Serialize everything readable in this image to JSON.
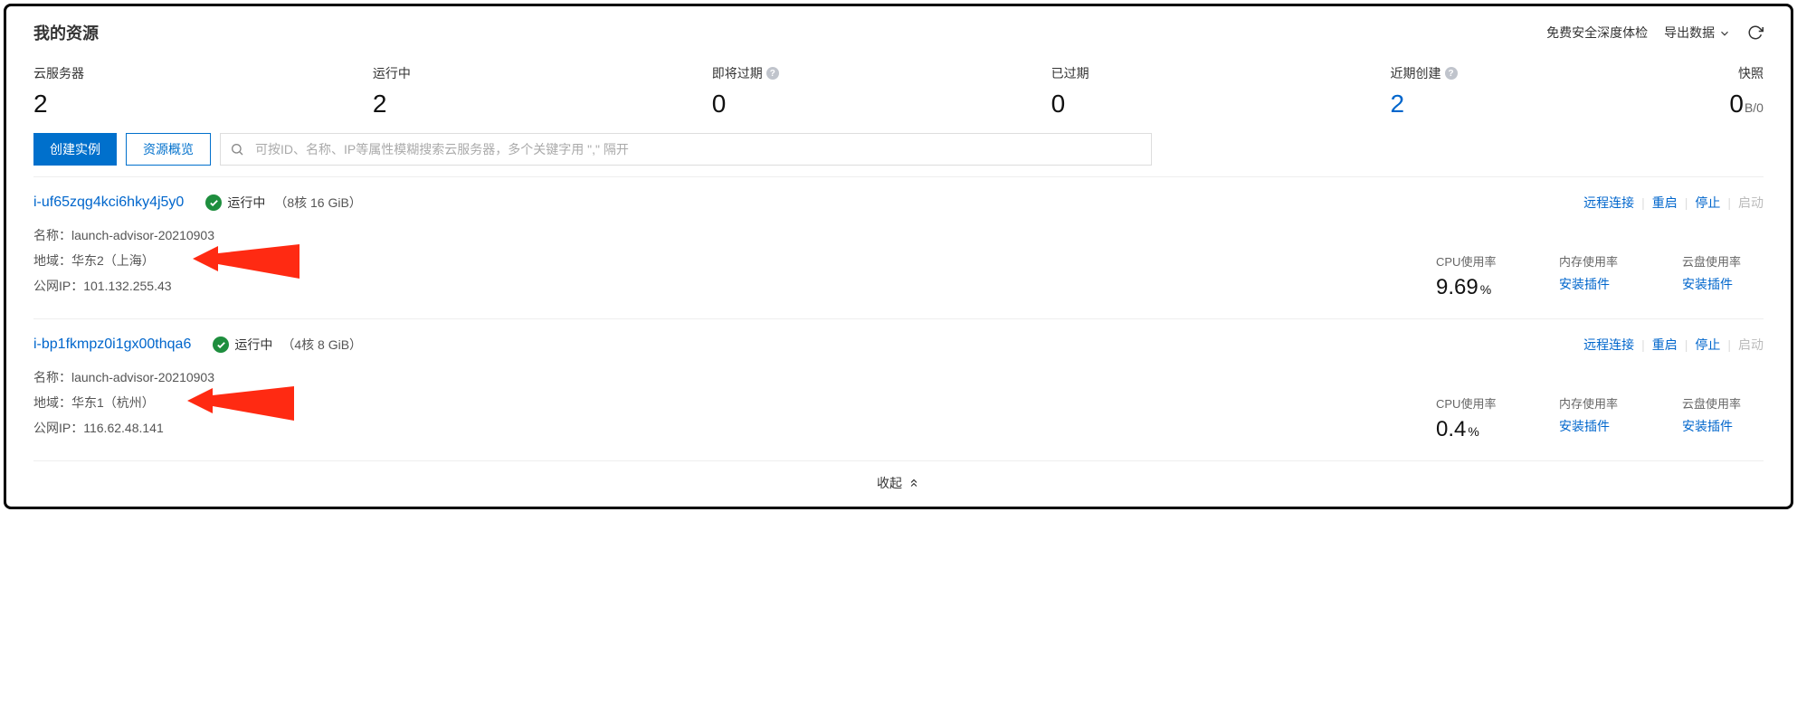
{
  "header": {
    "title": "我的资源",
    "security_check": "免费安全深度体检",
    "export": "导出数据"
  },
  "stats": {
    "servers": {
      "label": "云服务器",
      "value": "2"
    },
    "running": {
      "label": "运行中",
      "value": "2"
    },
    "expiring": {
      "label": "即将过期",
      "value": "0"
    },
    "expired": {
      "label": "已过期",
      "value": "0"
    },
    "recent": {
      "label": "近期创建",
      "value": "2"
    },
    "snapshot": {
      "label": "快照",
      "value": "0",
      "suffix": "B/0"
    }
  },
  "toolbar": {
    "create": "创建实例",
    "overview": "资源概览",
    "search_placeholder": "可按ID、名称、IP等属性模糊搜索云服务器，多个关键字用 \",\" 隔开"
  },
  "action_labels": {
    "remote": "远程连接",
    "restart": "重启",
    "stop": "停止",
    "start": "启动"
  },
  "metric_labels": {
    "cpu": "CPU使用率",
    "mem": "内存使用率",
    "disk": "云盘使用率",
    "install": "安装插件"
  },
  "meta_labels": {
    "name": "名称：",
    "region": "地域：",
    "ip": "公网IP："
  },
  "instances": [
    {
      "id": "i-uf65zqg4kci6hky4j5y0",
      "status": "运行中",
      "spec": "（8核 16 GiB）",
      "name": "launch-advisor-20210903",
      "region": "华东2（上海）",
      "ip": "101.132.255.43",
      "cpu": "9.69"
    },
    {
      "id": "i-bp1fkmpz0i1gx00thqa6",
      "status": "运行中",
      "spec": "（4核 8 GiB）",
      "name": "launch-advisor-20210903",
      "region": "华东1（杭州）",
      "ip": "116.62.48.141",
      "cpu": "0.4"
    }
  ],
  "collapse": "收起"
}
